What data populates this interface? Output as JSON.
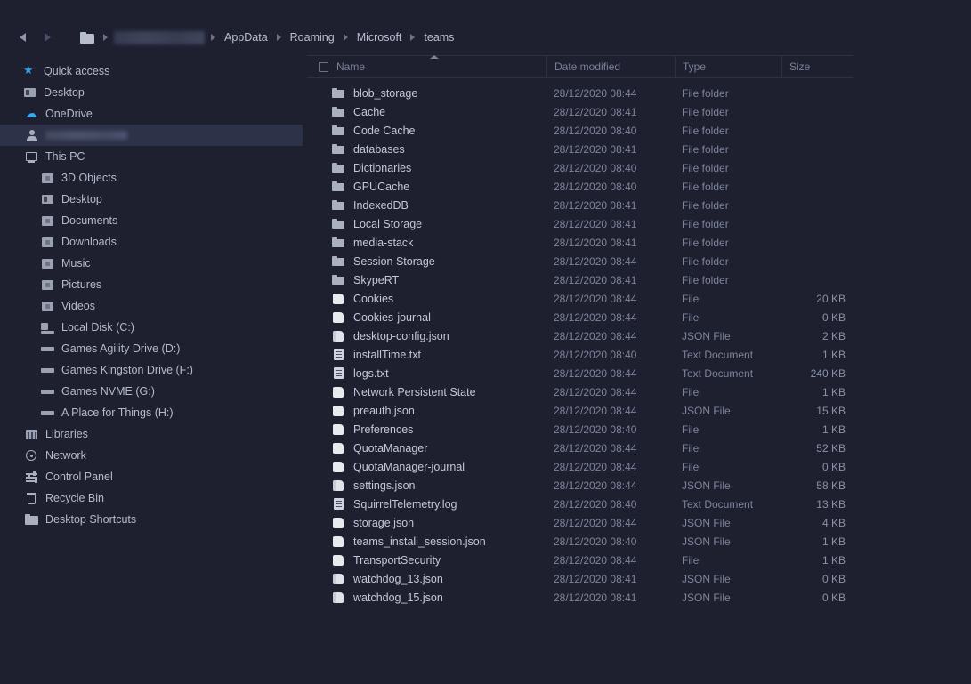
{
  "nav": {
    "back_label": "Back",
    "forward_label": "Forward",
    "breadcrumb": [
      {
        "label": "",
        "type": "folder-icon"
      },
      {
        "label": "",
        "type": "redacted-user"
      },
      {
        "label": "AppData",
        "type": "text"
      },
      {
        "label": "Roaming",
        "type": "text"
      },
      {
        "label": "Microsoft",
        "type": "text"
      },
      {
        "label": "teams",
        "type": "text"
      }
    ]
  },
  "sidebar": {
    "items": [
      {
        "label": "Quick access",
        "icon": "star-icon",
        "level": 0,
        "selected": false
      },
      {
        "label": "Desktop",
        "icon": "desktop-icon",
        "level": 0,
        "selected": false
      },
      {
        "label": "OneDrive",
        "icon": "onedrive-cloud-icon",
        "level": 1,
        "selected": false
      },
      {
        "label": "",
        "icon": "user-icon",
        "level": 1,
        "selected": true,
        "redacted": true
      },
      {
        "label": "This PC",
        "icon": "monitor-icon",
        "level": 1,
        "selected": false
      },
      {
        "label": "3D Objects",
        "icon": "box-icon",
        "level": 2,
        "selected": false
      },
      {
        "label": "Desktop",
        "icon": "desktop-folder-icon",
        "level": 2,
        "selected": false
      },
      {
        "label": "Documents",
        "icon": "documents-icon",
        "level": 2,
        "selected": false
      },
      {
        "label": "Downloads",
        "icon": "downloads-icon",
        "level": 2,
        "selected": false
      },
      {
        "label": "Music",
        "icon": "music-icon",
        "level": 2,
        "selected": false
      },
      {
        "label": "Pictures",
        "icon": "pictures-icon",
        "level": 2,
        "selected": false
      },
      {
        "label": "Videos",
        "icon": "videos-icon",
        "level": 2,
        "selected": false
      },
      {
        "label": "Local Disk (C:)",
        "icon": "harddisk-icon",
        "level": 2,
        "selected": false
      },
      {
        "label": "Games Agility Drive (D:)",
        "icon": "drive-icon",
        "level": 2,
        "selected": false
      },
      {
        "label": "Games Kingston Drive (F:)",
        "icon": "drive-icon",
        "level": 2,
        "selected": false
      },
      {
        "label": "Games NVME (G:)",
        "icon": "drive-icon",
        "level": 2,
        "selected": false
      },
      {
        "label": "A Place for Things (H:)",
        "icon": "drive-icon",
        "level": 2,
        "selected": false
      },
      {
        "label": "Libraries",
        "icon": "libraries-icon",
        "level": 1,
        "selected": false
      },
      {
        "label": "Network",
        "icon": "network-icon",
        "level": 1,
        "selected": false
      },
      {
        "label": "Control Panel",
        "icon": "control-panel-icon",
        "level": 1,
        "selected": false
      },
      {
        "label": "Recycle Bin",
        "icon": "recycle-bin-icon",
        "level": 1,
        "selected": false
      },
      {
        "label": "Desktop Shortcuts",
        "icon": "folder-icon",
        "level": 1,
        "selected": false
      }
    ]
  },
  "filelist": {
    "columns": [
      {
        "label": "Name",
        "sorted": "asc"
      },
      {
        "label": "Date modified",
        "sorted": ""
      },
      {
        "label": "Type",
        "sorted": ""
      },
      {
        "label": "Size",
        "sorted": ""
      }
    ],
    "select_all_checkbox": false,
    "rows": [
      {
        "name": "blob_storage",
        "date": "28/12/2020 08:44",
        "type": "File folder",
        "size": "",
        "icon": "folder"
      },
      {
        "name": "Cache",
        "date": "28/12/2020 08:41",
        "type": "File folder",
        "size": "",
        "icon": "folder"
      },
      {
        "name": "Code Cache",
        "date": "28/12/2020 08:40",
        "type": "File folder",
        "size": "",
        "icon": "folder"
      },
      {
        "name": "databases",
        "date": "28/12/2020 08:41",
        "type": "File folder",
        "size": "",
        "icon": "folder"
      },
      {
        "name": "Dictionaries",
        "date": "28/12/2020 08:40",
        "type": "File folder",
        "size": "",
        "icon": "folder"
      },
      {
        "name": "GPUCache",
        "date": "28/12/2020 08:40",
        "type": "File folder",
        "size": "",
        "icon": "folder"
      },
      {
        "name": "IndexedDB",
        "date": "28/12/2020 08:41",
        "type": "File folder",
        "size": "",
        "icon": "folder"
      },
      {
        "name": "Local Storage",
        "date": "28/12/2020 08:41",
        "type": "File folder",
        "size": "",
        "icon": "folder"
      },
      {
        "name": "media-stack",
        "date": "28/12/2020 08:41",
        "type": "File folder",
        "size": "",
        "icon": "folder"
      },
      {
        "name": "Session Storage",
        "date": "28/12/2020 08:44",
        "type": "File folder",
        "size": "",
        "icon": "folder"
      },
      {
        "name": "SkypeRT",
        "date": "28/12/2020 08:41",
        "type": "File folder",
        "size": "",
        "icon": "folder"
      },
      {
        "name": "Cookies",
        "date": "28/12/2020 08:44",
        "type": "File",
        "size": "20 KB",
        "icon": "file"
      },
      {
        "name": "Cookies-journal",
        "date": "28/12/2020 08:44",
        "type": "File",
        "size": "0 KB",
        "icon": "file"
      },
      {
        "name": "desktop-config.json",
        "date": "28/12/2020 08:44",
        "type": "JSON File",
        "size": "2 KB",
        "icon": "json"
      },
      {
        "name": "installTime.txt",
        "date": "28/12/2020 08:40",
        "type": "Text Document",
        "size": "1 KB",
        "icon": "txt"
      },
      {
        "name": "logs.txt",
        "date": "28/12/2020 08:44",
        "type": "Text Document",
        "size": "240 KB",
        "icon": "txt"
      },
      {
        "name": "Network Persistent State",
        "date": "28/12/2020 08:44",
        "type": "File",
        "size": "1 KB",
        "icon": "file"
      },
      {
        "name": "preauth.json",
        "date": "28/12/2020 08:44",
        "type": "JSON File",
        "size": "15 KB",
        "icon": "file"
      },
      {
        "name": "Preferences",
        "date": "28/12/2020 08:40",
        "type": "File",
        "size": "1 KB",
        "icon": "file"
      },
      {
        "name": "QuotaManager",
        "date": "28/12/2020 08:44",
        "type": "File",
        "size": "52 KB",
        "icon": "file"
      },
      {
        "name": "QuotaManager-journal",
        "date": "28/12/2020 08:44",
        "type": "File",
        "size": "0 KB",
        "icon": "file"
      },
      {
        "name": "settings.json",
        "date": "28/12/2020 08:44",
        "type": "JSON File",
        "size": "58 KB",
        "icon": "json"
      },
      {
        "name": "SquirrelTelemetry.log",
        "date": "28/12/2020 08:40",
        "type": "Text Document",
        "size": "13 KB",
        "icon": "txt"
      },
      {
        "name": "storage.json",
        "date": "28/12/2020 08:44",
        "type": "JSON File",
        "size": "4 KB",
        "icon": "file"
      },
      {
        "name": "teams_install_session.json",
        "date": "28/12/2020 08:40",
        "type": "JSON File",
        "size": "1 KB",
        "icon": "file"
      },
      {
        "name": "TransportSecurity",
        "date": "28/12/2020 08:44",
        "type": "File",
        "size": "1 KB",
        "icon": "file"
      },
      {
        "name": "watchdog_13.json",
        "date": "28/12/2020 08:41",
        "type": "JSON File",
        "size": "0 KB",
        "icon": "json"
      },
      {
        "name": "watchdog_15.json",
        "date": "28/12/2020 08:41",
        "type": "JSON File",
        "size": "0 KB",
        "icon": "json"
      }
    ]
  },
  "colors": {
    "background": "#1e2030",
    "selected_row": "#2d3248",
    "accent_blue": "#2f9fe8",
    "text_primary": "#c2c8d8",
    "text_muted": "#7d849a"
  }
}
